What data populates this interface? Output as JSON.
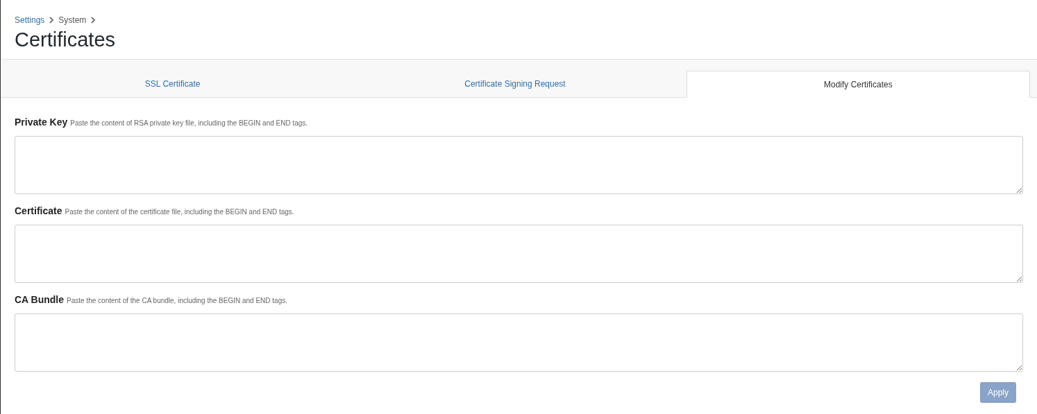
{
  "breadcrumb": [
    {
      "label": "Settings",
      "kind": "link"
    },
    {
      "label": "System",
      "kind": "current"
    }
  ],
  "title": "Certificates",
  "tabs": [
    {
      "label": "SSL Certificate",
      "selected": false
    },
    {
      "label": "Certificate Signing Request",
      "selected": false
    },
    {
      "label": "Modify Certificates",
      "selected": true
    }
  ],
  "fields": [
    {
      "label": "Private Key",
      "hint": "Paste the content of RSA private key file, including the BEGIN and END tags."
    },
    {
      "label": "Certificate",
      "hint": "Paste the content of the certificate file, including the BEGIN and END tags."
    },
    {
      "label": "CA Bundle",
      "hint": "Paste the content of the CA bundle, including the BEGIN and END tags."
    }
  ],
  "apply_button": {
    "label": "Apply",
    "disabled": true
  }
}
